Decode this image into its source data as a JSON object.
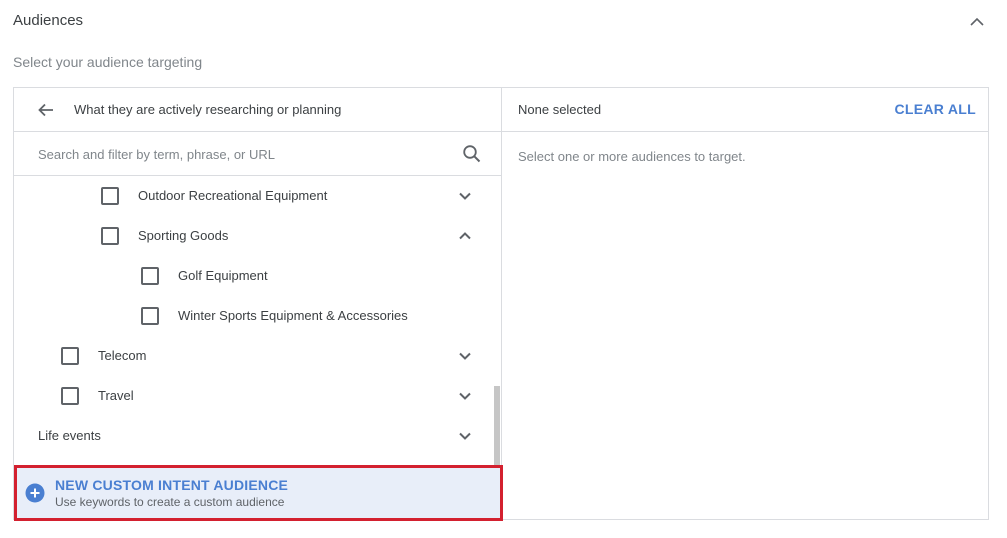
{
  "section": {
    "title": "Audiences",
    "subtitle": "Select your audience targeting"
  },
  "left_pane": {
    "header_title": "What they are actively researching or planning",
    "search_placeholder": "Search and filter by term, phrase, or URL",
    "items": [
      {
        "label": "Outdoor Recreational Equipment",
        "checked": false,
        "expander": "chevron-down"
      },
      {
        "label": "Sporting Goods",
        "checked": false,
        "expander": "chevron-up"
      },
      {
        "label": "Golf Equipment",
        "checked": false,
        "expander": "none"
      },
      {
        "label": "Winter Sports Equipment & Accessories",
        "checked": false,
        "expander": "none"
      },
      {
        "label": "Telecom",
        "checked": false,
        "expander": "chevron-down"
      },
      {
        "label": "Travel",
        "checked": false,
        "expander": "chevron-down"
      },
      {
        "label": "Life events",
        "checked": null,
        "expander": "chevron-down"
      }
    ],
    "new_audience": {
      "title": "NEW CUSTOM INTENT AUDIENCE",
      "subtitle": "Use keywords to create a custom audience"
    }
  },
  "right_pane": {
    "status": "None selected",
    "clear_label": "CLEAR ALL",
    "hint": "Select one or more audiences to target."
  },
  "colors": {
    "accent": "#4a7fd1",
    "highlight": "#d3202f",
    "new_audience_bg": "#e8eef9"
  },
  "icons": {
    "collapse": "chevron-up-icon",
    "back": "arrow-back-icon",
    "search": "search-icon",
    "add": "plus-circle-icon"
  }
}
